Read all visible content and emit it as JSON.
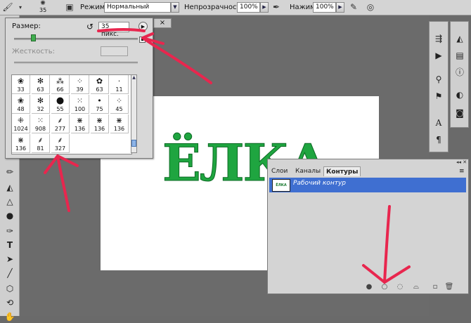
{
  "options_bar": {
    "brush_size": "35",
    "mode_label": "Режим:",
    "mode_value": "Нормальный",
    "opacity_label": "Непрозрачность:",
    "opacity_value": "100%",
    "flow_label": "Нажим:",
    "flow_value": "100%",
    "icons": [
      "brush-tool-icon",
      "brush-preset-icon",
      "brush-panel-icon",
      "airbrush-icon",
      "pressure-icon"
    ]
  },
  "brush_picker": {
    "size_label": "Размер:",
    "size_value": "35 пикс.",
    "hardness_label": "Жесткость:",
    "brushes": [
      "33",
      "63",
      "66",
      "39",
      "63",
      "11",
      "48",
      "32",
      "55",
      "100",
      "75",
      "45",
      "1024",
      "908",
      "277",
      "136",
      "136",
      "136",
      "136",
      "81",
      "327"
    ]
  },
  "document": {
    "tab_close": "×",
    "canvas_text": "ЁЛКА"
  },
  "paths_panel": {
    "tabs": [
      "Слои",
      "Каналы",
      "Контуры"
    ],
    "active_tab": "Контуры",
    "thumb_text": "ЁЛКА",
    "path_name": "Рабочий контур"
  },
  "toolbox": {
    "text_tool": "T"
  },
  "colors": {
    "text_green": "#1fa540",
    "annotation_red": "#e8264e",
    "selection_blue": "#3f6fd1"
  }
}
